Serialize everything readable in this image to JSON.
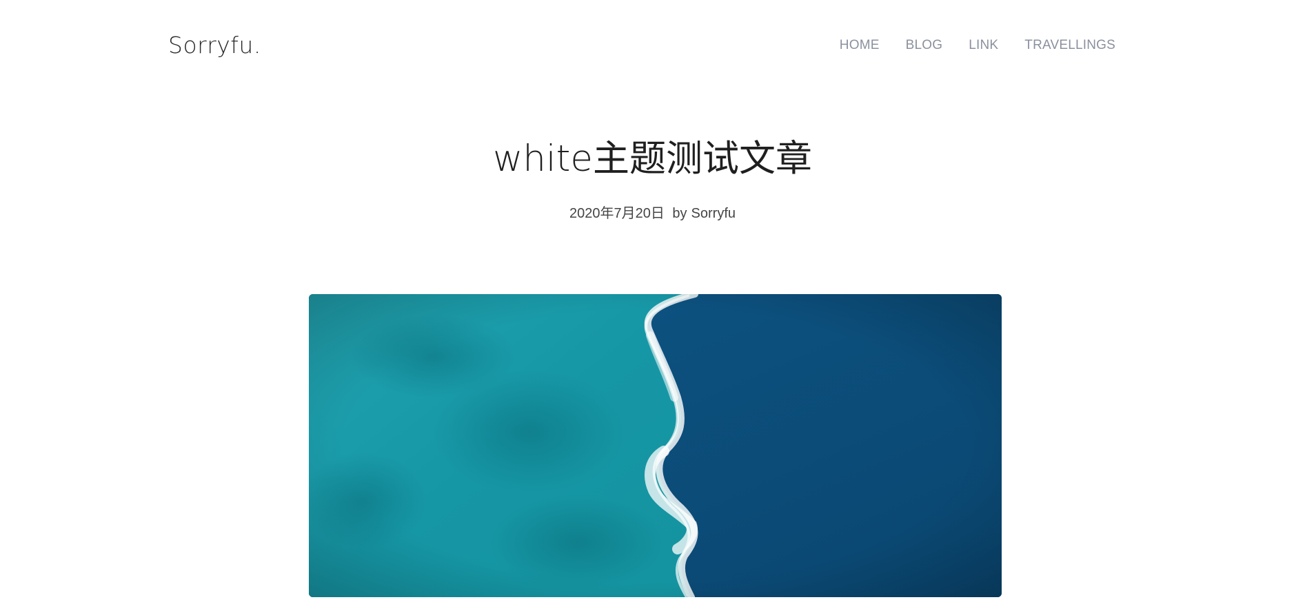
{
  "site": {
    "brand": "Sorryfu."
  },
  "nav": {
    "items": [
      {
        "label": "HOME"
      },
      {
        "label": "BLOG"
      },
      {
        "label": "LINK"
      },
      {
        "label": "TRAVELLINGS"
      }
    ]
  },
  "post": {
    "title": "white主题测试文章",
    "date": "2020年7月20日",
    "by_label": "by",
    "author": "Sorryfu"
  },
  "colors": {
    "background": "#ffffff",
    "nav_text": "#8a909e",
    "title_text": "#1f1f1f",
    "hero_turquoise": "#1a9fae",
    "hero_deep_blue": "#0b4d7a"
  },
  "icons": {
    "hero_image": "ocean-aerial-image"
  }
}
